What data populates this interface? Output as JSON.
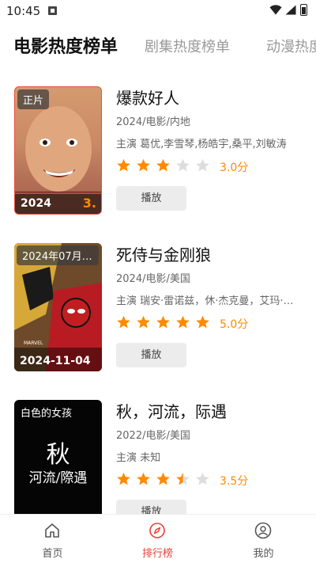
{
  "status_bar": {
    "time": "10:45"
  },
  "tabs": [
    {
      "label": "电影热度榜单",
      "active": true
    },
    {
      "label": "剧集热度榜单",
      "active": false
    },
    {
      "label": "动漫热度榜单",
      "active": false
    }
  ],
  "items": [
    {
      "poster_tag": "正片",
      "poster_year": "2024",
      "poster_score": "3.",
      "title": "爆款好人",
      "meta": "2024/电影/内地",
      "cast": "主演 葛优,李雪琴,杨皓宇,桑平,刘敏涛",
      "rating_stars": 3,
      "rating_text": "3.0分",
      "play_label": "播放"
    },
    {
      "poster_tag": "2024年07月2...",
      "poster_year": "2024-11-04",
      "poster_score": "",
      "title": "死侍与金刚狼",
      "meta": "2024/电影/美国",
      "cast": "主演 瑞安·雷诺兹，休·杰克曼，艾玛·科...",
      "rating_stars": 5,
      "rating_text": "5.0分",
      "play_label": "播放"
    },
    {
      "poster_tag": "白色的女孩",
      "poster_big": "秋",
      "poster_sub": "河流/際遇",
      "poster_year": "",
      "poster_score": "",
      "title": "秋，河流，际遇",
      "meta": "2022/电影/美国",
      "cast": "主演 未知",
      "rating_stars": 3.5,
      "rating_text": "3.5分",
      "play_label": "播放"
    }
  ],
  "bottom_nav": [
    {
      "label": "首页",
      "icon": "home-icon",
      "active": false
    },
    {
      "label": "排行榜",
      "icon": "compass-icon",
      "active": true
    },
    {
      "label": "我的",
      "icon": "profile-icon",
      "active": false
    }
  ],
  "colors": {
    "accent": "#e8413b",
    "star": "#ff8a00",
    "star_empty": "#dddddd"
  }
}
